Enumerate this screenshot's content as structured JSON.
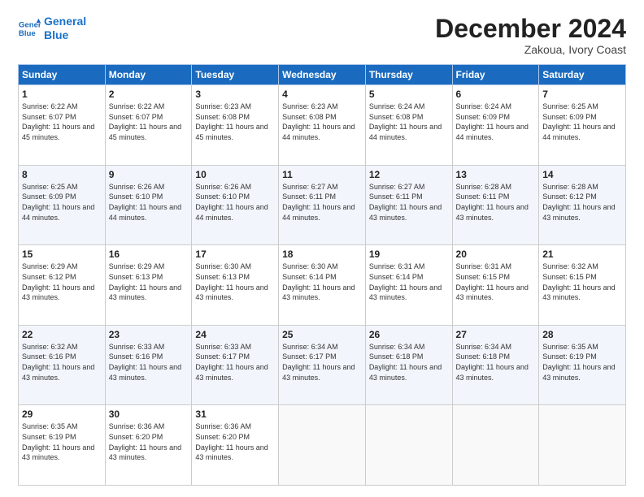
{
  "header": {
    "logo_line1": "General",
    "logo_line2": "Blue",
    "month_title": "December 2024",
    "subtitle": "Zakoua, Ivory Coast"
  },
  "days_of_week": [
    "Sunday",
    "Monday",
    "Tuesday",
    "Wednesday",
    "Thursday",
    "Friday",
    "Saturday"
  ],
  "weeks": [
    [
      {
        "day": 1,
        "sunrise": "6:22 AM",
        "sunset": "6:07 PM",
        "daylight": "11 hours and 45 minutes."
      },
      {
        "day": 2,
        "sunrise": "6:22 AM",
        "sunset": "6:07 PM",
        "daylight": "11 hours and 45 minutes."
      },
      {
        "day": 3,
        "sunrise": "6:23 AM",
        "sunset": "6:08 PM",
        "daylight": "11 hours and 45 minutes."
      },
      {
        "day": 4,
        "sunrise": "6:23 AM",
        "sunset": "6:08 PM",
        "daylight": "11 hours and 44 minutes."
      },
      {
        "day": 5,
        "sunrise": "6:24 AM",
        "sunset": "6:08 PM",
        "daylight": "11 hours and 44 minutes."
      },
      {
        "day": 6,
        "sunrise": "6:24 AM",
        "sunset": "6:09 PM",
        "daylight": "11 hours and 44 minutes."
      },
      {
        "day": 7,
        "sunrise": "6:25 AM",
        "sunset": "6:09 PM",
        "daylight": "11 hours and 44 minutes."
      }
    ],
    [
      {
        "day": 8,
        "sunrise": "6:25 AM",
        "sunset": "6:09 PM",
        "daylight": "11 hours and 44 minutes."
      },
      {
        "day": 9,
        "sunrise": "6:26 AM",
        "sunset": "6:10 PM",
        "daylight": "11 hours and 44 minutes."
      },
      {
        "day": 10,
        "sunrise": "6:26 AM",
        "sunset": "6:10 PM",
        "daylight": "11 hours and 44 minutes."
      },
      {
        "day": 11,
        "sunrise": "6:27 AM",
        "sunset": "6:11 PM",
        "daylight": "11 hours and 44 minutes."
      },
      {
        "day": 12,
        "sunrise": "6:27 AM",
        "sunset": "6:11 PM",
        "daylight": "11 hours and 43 minutes."
      },
      {
        "day": 13,
        "sunrise": "6:28 AM",
        "sunset": "6:11 PM",
        "daylight": "11 hours and 43 minutes."
      },
      {
        "day": 14,
        "sunrise": "6:28 AM",
        "sunset": "6:12 PM",
        "daylight": "11 hours and 43 minutes."
      }
    ],
    [
      {
        "day": 15,
        "sunrise": "6:29 AM",
        "sunset": "6:12 PM",
        "daylight": "11 hours and 43 minutes."
      },
      {
        "day": 16,
        "sunrise": "6:29 AM",
        "sunset": "6:13 PM",
        "daylight": "11 hours and 43 minutes."
      },
      {
        "day": 17,
        "sunrise": "6:30 AM",
        "sunset": "6:13 PM",
        "daylight": "11 hours and 43 minutes."
      },
      {
        "day": 18,
        "sunrise": "6:30 AM",
        "sunset": "6:14 PM",
        "daylight": "11 hours and 43 minutes."
      },
      {
        "day": 19,
        "sunrise": "6:31 AM",
        "sunset": "6:14 PM",
        "daylight": "11 hours and 43 minutes."
      },
      {
        "day": 20,
        "sunrise": "6:31 AM",
        "sunset": "6:15 PM",
        "daylight": "11 hours and 43 minutes."
      },
      {
        "day": 21,
        "sunrise": "6:32 AM",
        "sunset": "6:15 PM",
        "daylight": "11 hours and 43 minutes."
      }
    ],
    [
      {
        "day": 22,
        "sunrise": "6:32 AM",
        "sunset": "6:16 PM",
        "daylight": "11 hours and 43 minutes."
      },
      {
        "day": 23,
        "sunrise": "6:33 AM",
        "sunset": "6:16 PM",
        "daylight": "11 hours and 43 minutes."
      },
      {
        "day": 24,
        "sunrise": "6:33 AM",
        "sunset": "6:17 PM",
        "daylight": "11 hours and 43 minutes."
      },
      {
        "day": 25,
        "sunrise": "6:34 AM",
        "sunset": "6:17 PM",
        "daylight": "11 hours and 43 minutes."
      },
      {
        "day": 26,
        "sunrise": "6:34 AM",
        "sunset": "6:18 PM",
        "daylight": "11 hours and 43 minutes."
      },
      {
        "day": 27,
        "sunrise": "6:34 AM",
        "sunset": "6:18 PM",
        "daylight": "11 hours and 43 minutes."
      },
      {
        "day": 28,
        "sunrise": "6:35 AM",
        "sunset": "6:19 PM",
        "daylight": "11 hours and 43 minutes."
      }
    ],
    [
      {
        "day": 29,
        "sunrise": "6:35 AM",
        "sunset": "6:19 PM",
        "daylight": "11 hours and 43 minutes."
      },
      {
        "day": 30,
        "sunrise": "6:36 AM",
        "sunset": "6:20 PM",
        "daylight": "11 hours and 43 minutes."
      },
      {
        "day": 31,
        "sunrise": "6:36 AM",
        "sunset": "6:20 PM",
        "daylight": "11 hours and 43 minutes."
      },
      null,
      null,
      null,
      null
    ]
  ]
}
